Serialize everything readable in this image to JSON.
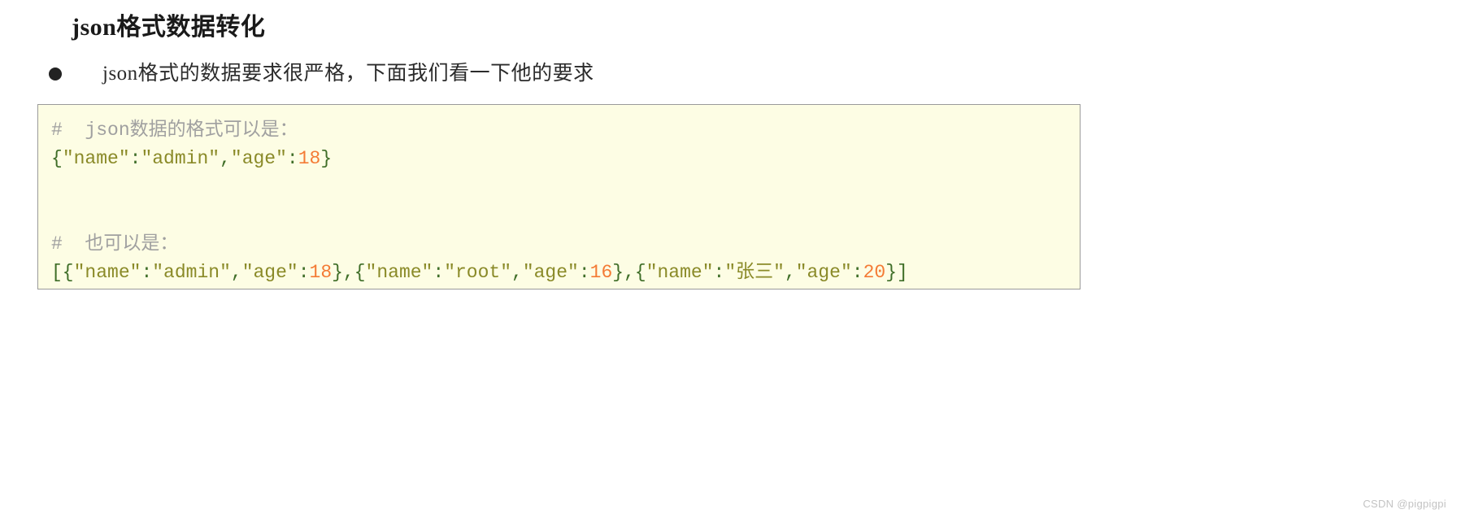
{
  "page": {
    "title": "json格式数据转化",
    "background_color": "#ffffff"
  },
  "bullet": {
    "marker": "bullet-dot",
    "text": "json格式的数据要求很严格，下面我们看一下他的要求"
  },
  "code_block": {
    "background_color": "#fdfde4",
    "border_color": "#9a9a9a",
    "colors": {
      "comment": "#a0a0a0",
      "punctuation": "#3f6e28",
      "string": "#8a8a28",
      "number": "#f47b35"
    },
    "lines": [
      {
        "type": "comment",
        "text": "#  json数据的格式可以是："
      },
      {
        "type": "code",
        "text": "{\"name\":\"admin\",\"age\":18}",
        "tokens": [
          {
            "t": "{",
            "k": "punct"
          },
          {
            "t": "″name″",
            "k": "string"
          },
          {
            "t": ":",
            "k": "punct"
          },
          {
            "t": "″admin″",
            "k": "string"
          },
          {
            "t": ",",
            "k": "punct"
          },
          {
            "t": "″age″",
            "k": "string"
          },
          {
            "t": ":",
            "k": "punct"
          },
          {
            "t": "18",
            "k": "number"
          },
          {
            "t": "}",
            "k": "punct"
          }
        ]
      },
      {
        "type": "blank",
        "text": ""
      },
      {
        "type": "blank",
        "text": ""
      },
      {
        "type": "comment",
        "text": "#  也可以是："
      },
      {
        "type": "code",
        "text": "[{\"name\":\"admin\",\"age\":18},{\"name\":\"root\",\"age\":16},{\"name\":\"张三\",\"age\":20}]",
        "tokens": [
          {
            "t": "[{",
            "k": "punct"
          },
          {
            "t": "″name″",
            "k": "string"
          },
          {
            "t": ":",
            "k": "punct"
          },
          {
            "t": "″admin″",
            "k": "string"
          },
          {
            "t": ",",
            "k": "punct"
          },
          {
            "t": "″age″",
            "k": "string"
          },
          {
            "t": ":",
            "k": "punct"
          },
          {
            "t": "18",
            "k": "number"
          },
          {
            "t": "},{",
            "k": "punct"
          },
          {
            "t": "″name″",
            "k": "string"
          },
          {
            "t": ":",
            "k": "punct"
          },
          {
            "t": "″root″",
            "k": "string"
          },
          {
            "t": ",",
            "k": "punct"
          },
          {
            "t": "″age″",
            "k": "string"
          },
          {
            "t": ":",
            "k": "punct"
          },
          {
            "t": "16",
            "k": "number"
          },
          {
            "t": "},{",
            "k": "punct"
          },
          {
            "t": "″name″",
            "k": "string"
          },
          {
            "t": ":",
            "k": "punct"
          },
          {
            "t": "″张三″",
            "k": "string"
          },
          {
            "t": ",",
            "k": "punct"
          },
          {
            "t": "″age″",
            "k": "string"
          },
          {
            "t": ":",
            "k": "punct"
          },
          {
            "t": "20",
            "k": "number"
          },
          {
            "t": "}]",
            "k": "punct"
          }
        ]
      }
    ]
  },
  "watermark": {
    "text": "CSDN @pigpigpi"
  }
}
